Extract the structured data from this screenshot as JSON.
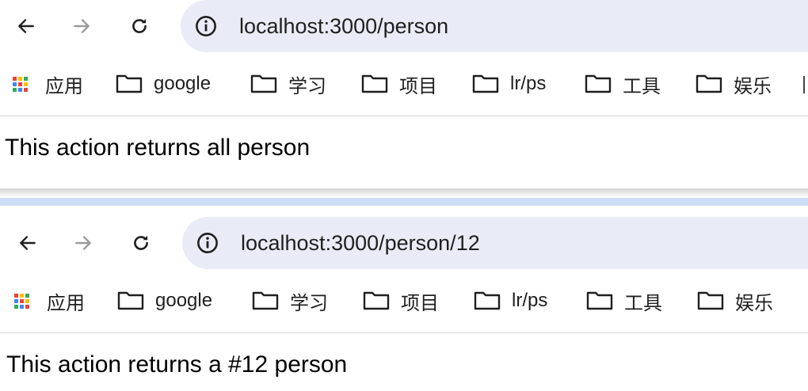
{
  "windows": [
    {
      "url": "localhost:3000/person",
      "bookmarks": [
        "应用",
        "google",
        "学习",
        "项目",
        "lr/ps",
        "工具",
        "娱乐"
      ],
      "content_text": "This action returns all person"
    },
    {
      "url": "localhost:3000/person/12",
      "bookmarks": [
        "应用",
        "google",
        "学习",
        "项目",
        "lr/ps",
        "工具",
        "娱乐"
      ],
      "content_text": "This action returns a #12 person"
    }
  ],
  "colors": {
    "omnibox_bg": "#e9ebf6",
    "divider_blue": "#cfdcf5",
    "apps_grid": [
      "#ea4335",
      "#fbbc05",
      "#34a853",
      "#4285f4",
      "#ea4335",
      "#fbbc05",
      "#34a853",
      "#4285f4",
      "#ea4335"
    ]
  },
  "icons": {
    "back": "arrow-left-icon",
    "forward": "arrow-right-icon",
    "reload": "reload-icon",
    "site_info": "info-icon",
    "apps": "apps-grid-icon",
    "folder": "folder-icon"
  }
}
